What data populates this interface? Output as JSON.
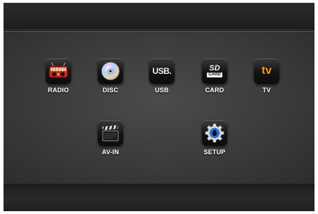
{
  "apps": [
    {
      "label": "RADIO",
      "icon": "radio-icon"
    },
    {
      "label": "DISC",
      "icon": "disc-icon"
    },
    {
      "label": "USB",
      "icon": "usb-icon",
      "badge": "USB."
    },
    {
      "label": "CARD",
      "icon": "sd-card-icon",
      "badge_top": "SD",
      "badge_bottom": "CARD"
    },
    {
      "label": "TV",
      "icon": "tv-icon",
      "badge": "tv"
    },
    {
      "label": "AV-IN",
      "icon": "clapperboard-icon"
    },
    {
      "label": "SETUP",
      "icon": "gear-icon"
    }
  ],
  "colors": {
    "accent_tv": "#f0a020",
    "radio_red": "#c8282a",
    "setup_blue": "#1f74d8"
  }
}
